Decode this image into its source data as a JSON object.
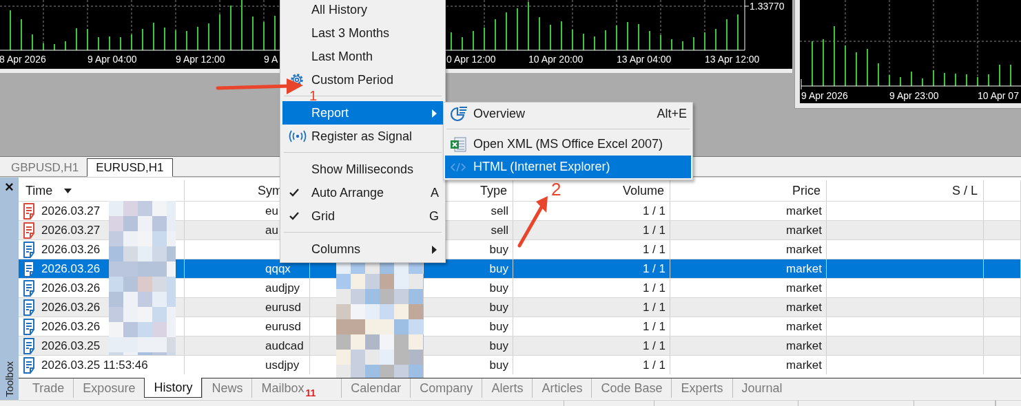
{
  "main_chart": {
    "price_label": "1.33770",
    "axis_labels_left": [
      "8 Apr 2026",
      "9 Apr 04:00",
      "9 Apr 12:00",
      "9 A"
    ],
    "axis_labels_right": [
      "0 Apr 12:00",
      "10 Apr 20:00",
      "13 Apr 04:00",
      "13 Apr 12:00"
    ]
  },
  "side_chart": {
    "axis_labels": [
      "9 Apr 2026",
      "9 Apr 23:00",
      "10 Apr 07"
    ]
  },
  "chart_tabs": [
    {
      "label": "GBPUSD,H1",
      "selected": false
    },
    {
      "label": "EURUSD,H1",
      "selected": true
    }
  ],
  "context_menu": {
    "items": [
      {
        "kind": "plain",
        "label": "All History",
        "checked": false,
        "selected": false
      },
      {
        "kind": "plain",
        "label": "Last 3 Months",
        "checked": false,
        "selected": false
      },
      {
        "kind": "plain",
        "label": "Last Month",
        "checked": false,
        "selected": false
      },
      {
        "kind": "custom",
        "label": "Custom Period",
        "checked": false,
        "selected": false
      },
      {
        "kind": "separator"
      },
      {
        "kind": "plain",
        "label": "Report",
        "checked": false,
        "selected": true,
        "submenu": true
      },
      {
        "kind": "signal",
        "label": "Register as Signal",
        "checked": false,
        "selected": false
      },
      {
        "kind": "separator"
      },
      {
        "kind": "plain",
        "label": "Show Milliseconds",
        "checked": false,
        "selected": false
      },
      {
        "kind": "plain",
        "label": "Auto Arrange",
        "checked": true,
        "selected": false,
        "shortcut": "A"
      },
      {
        "kind": "plain",
        "label": "Grid",
        "checked": true,
        "selected": false,
        "shortcut": "G"
      },
      {
        "kind": "separator"
      },
      {
        "kind": "plain",
        "label": "Columns",
        "checked": false,
        "selected": false,
        "submenu": true
      }
    ]
  },
  "submenu": {
    "items": [
      {
        "kind": "overview",
        "label": "Overview",
        "shortcut": "Alt+E",
        "selected": false
      },
      {
        "kind": "separator"
      },
      {
        "kind": "xml",
        "label": "Open XML (MS Office Excel 2007)",
        "selected": false
      },
      {
        "kind": "html",
        "label": "HTML (Internet Explorer)",
        "selected": true
      }
    ]
  },
  "annotations": [
    {
      "label": "1"
    },
    {
      "label": "2"
    }
  ],
  "toolbox": {
    "close": "×",
    "title": "Toolbox"
  },
  "table": {
    "columns": [
      {
        "label": "Time",
        "sorted": true
      },
      {
        "label": "Sym",
        "sorted": false
      },
      {},
      {
        "label": "Type",
        "sorted": false
      },
      {
        "label": "Volume",
        "sorted": false
      },
      {
        "label": "Price",
        "sorted": false
      },
      {
        "label": "S / L",
        "sorted": false
      },
      {}
    ],
    "rows": [
      {
        "color": "#d8483c",
        "time": "2026.03.27",
        "symbol": "eu",
        "type": "sell",
        "volume": "1 / 1",
        "price": "market",
        "selected": false
      },
      {
        "color": "#d8483c",
        "time": "2026.03.27",
        "symbol": "au",
        "type": "sell",
        "volume": "1 / 1",
        "price": "market",
        "selected": false
      },
      {
        "color": "#1e6fc0",
        "time": "2026.03.26",
        "type": "buy",
        "volume": "1 / 1",
        "price": "market",
        "selected": false
      },
      {
        "color": "#1e6fc0",
        "time": "2026.03.26",
        "symbol": "qqqx",
        "type": "buy",
        "volume": "1 / 1",
        "price": "market",
        "selected": true
      },
      {
        "color": "#1e6fc0",
        "time": "2026.03.26",
        "symbol": "audjpy",
        "type": "buy",
        "volume": "1 / 1",
        "price": "market",
        "selected": false
      },
      {
        "color": "#1e6fc0",
        "time": "2026.03.26",
        "symbol": "eurusd",
        "type": "buy",
        "volume": "1 / 1",
        "price": "market",
        "selected": false
      },
      {
        "color": "#1e6fc0",
        "time": "2026.03.26",
        "symbol": "eurusd",
        "type": "buy",
        "volume": "1 / 1",
        "price": "market",
        "selected": false
      },
      {
        "color": "#1e6fc0",
        "time": "2026.03.25",
        "symbol": "audcad",
        "type": "buy",
        "volume": "1 / 1",
        "price": "market",
        "selected": false
      },
      {
        "color": "#1e6fc0",
        "time": "2026.03.25 11:53:46",
        "symbol": "usdjpy",
        "type": "buy",
        "volume": "1 / 1",
        "price": "market",
        "selected": false
      }
    ]
  },
  "bottom_tabs": [
    {
      "label": "Trade",
      "selected": false
    },
    {
      "label": "Exposure",
      "selected": false
    },
    {
      "label": "History",
      "selected": true
    },
    {
      "label": "News",
      "selected": false
    },
    {
      "label": "Mailbox",
      "selected": false,
      "badge": "11"
    },
    {
      "label": "Calendar",
      "selected": false
    },
    {
      "label": "Company",
      "selected": false
    },
    {
      "label": "Alerts",
      "selected": false
    },
    {
      "label": "Articles",
      "selected": false
    },
    {
      "label": "Code Base",
      "selected": false
    },
    {
      "label": "Experts",
      "selected": false
    },
    {
      "label": "Journal",
      "selected": false
    }
  ]
}
